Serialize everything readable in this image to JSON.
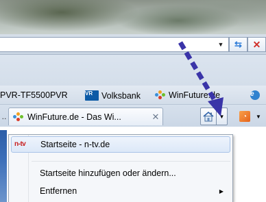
{
  "address_bar": {
    "dropdown_glyph": "▼",
    "refresh_glyph": "⇆",
    "stop_glyph": "✕"
  },
  "favorites_bar": {
    "items": [
      {
        "label": "PVR-TF5500PVR",
        "icon": "none"
      },
      {
        "label": "Volksbank",
        "icon": "volksbank-icon"
      },
      {
        "label": "WinFuture.de",
        "icon": "winfuture-icon"
      },
      {
        "label": "",
        "icon": "ie-icon"
      }
    ],
    "volksbank_icon_text": "VR",
    "ie_icon_text": "e"
  },
  "tab_bar": {
    "scroll_glyph": "..",
    "active_tab": {
      "label": "WinFuture.de - Das Wi...",
      "close_glyph": "✕"
    },
    "home_dropdown_glyph": "▼",
    "feed_icon_glyph": "◔",
    "feed_dropdown_glyph": "▼"
  },
  "home_menu": {
    "items": [
      {
        "icon": "n-tv",
        "label": "Startseite - n-tv.de",
        "selected": true
      },
      {
        "label": "Startseite hinzufügen oder ändern...",
        "selected": false
      },
      {
        "label": "Entfernen",
        "selected": false,
        "submenu_glyph": "▶"
      }
    ]
  },
  "colors": {
    "arrow": "#3a34a8",
    "menu_highlight_border": "#a8c3e8",
    "ntv_red": "#c81e1e"
  }
}
